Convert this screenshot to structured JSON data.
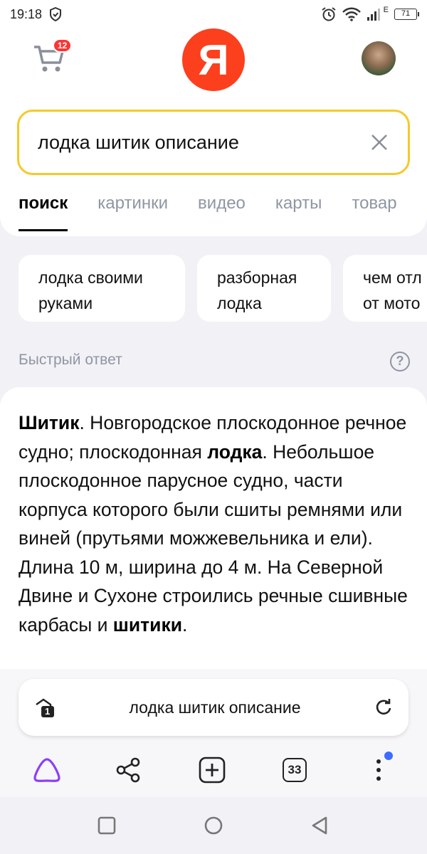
{
  "status": {
    "time": "19:18",
    "network": "E",
    "battery": "71"
  },
  "header": {
    "cart_count": "12",
    "logo_letter": "Я"
  },
  "search": {
    "query": "лодка шитик описание"
  },
  "tabs": [
    "поиск",
    "картинки",
    "видео",
    "карты",
    "товар"
  ],
  "chips": [
    {
      "line1": "лодка своими",
      "line2": "руками"
    },
    {
      "line1": "разборная",
      "line2": "лодка"
    },
    {
      "line1": "чем отл",
      "line2": "от мото"
    }
  ],
  "quick_answer": {
    "label": "Быстрый ответ",
    "help": "?",
    "term": "Шитик",
    "text1": ". Новгородское плоскодонное речное судно; плоскодонная ",
    "bold2": "лодка",
    "text2": ". Небольшое плоскодонное парусное судно, части корпуса которого были сшиты ремнями или виней (прутьями можжевельника и ели). Длина 10 м, ширина до 4 м. На Северной Двине и Сухоне строились речные сшивные карбасы и ",
    "bold3": "шитики",
    "text3": "."
  },
  "address_bar": {
    "url": "лодка шитик описание",
    "incognito_count": "1"
  },
  "toolbar": {
    "tab_count": "33"
  },
  "colors": {
    "accent_yellow": "#f5c92a",
    "yandex_red": "#fc3f1d",
    "alice_purple": "#8a3ffc",
    "dot_blue": "#3d6cff"
  }
}
